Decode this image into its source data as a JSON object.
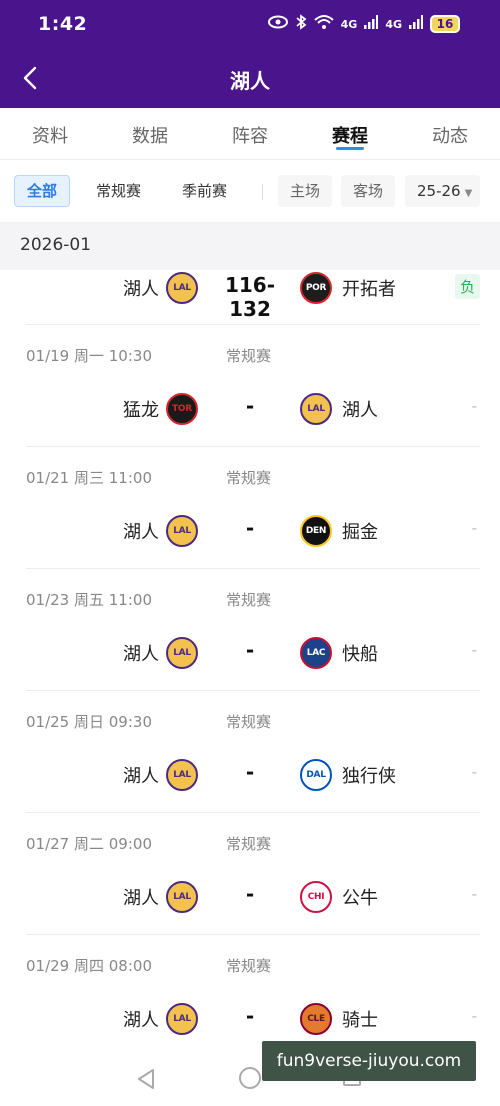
{
  "status_bar": {
    "time": "1:42",
    "signal_1": "4G",
    "signal_2": "4G",
    "battery": "16"
  },
  "header": {
    "title": "湖人"
  },
  "tabs": [
    {
      "label": "资料"
    },
    {
      "label": "数据"
    },
    {
      "label": "阵容"
    },
    {
      "label": "赛程",
      "active": true
    },
    {
      "label": "动态"
    }
  ],
  "filters": {
    "all": "全部",
    "regular": "常规赛",
    "preseason": "季前赛",
    "home": "主场",
    "away": "客场",
    "season": "25-26",
    "season_caret": "▼"
  },
  "month": "2026-01",
  "teams": {
    "LAL": {
      "abbr": "LAL",
      "bg": "#f2c14e",
      "fg": "#4b2a82",
      "ring": "#4b2a82"
    },
    "POR": {
      "abbr": "POR",
      "bg": "#1d1d1d",
      "fg": "#ffffff",
      "ring": "#d7262e"
    },
    "TOR": {
      "abbr": "TOR",
      "bg": "#1a1a1a",
      "fg": "#d7262e",
      "ring": "#d7262e"
    },
    "DEN": {
      "abbr": "DEN",
      "bg": "#111111",
      "fg": "#ffffff",
      "ring": "#fec524"
    },
    "LAC": {
      "abbr": "LAC",
      "bg": "#1d4289",
      "fg": "#ffffff",
      "ring": "#c8102e"
    },
    "DAL": {
      "abbr": "DAL",
      "bg": "#ffffff",
      "fg": "#0053bc",
      "ring": "#0053bc"
    },
    "CHI": {
      "abbr": "CHI",
      "bg": "#ffffff",
      "fg": "#ce1141",
      "ring": "#ce1141"
    },
    "CLE": {
      "abbr": "CLE",
      "bg": "#e27b2e",
      "fg": "#5a1a21",
      "ring": "#860038"
    }
  },
  "games": [
    {
      "date": "",
      "type": "",
      "home": "湖人",
      "home_team": "LAL",
      "score": "116-132",
      "away": "开拓者",
      "away_team": "POR",
      "result": "负"
    },
    {
      "date": "01/19  周一 10:30",
      "type": "常规赛",
      "home": "猛龙",
      "home_team": "TOR",
      "score": "-",
      "away": "湖人",
      "away_team": "LAL",
      "result": "-"
    },
    {
      "date": "01/21  周三 11:00",
      "type": "常规赛",
      "home": "湖人",
      "home_team": "LAL",
      "score": "-",
      "away": "掘金",
      "away_team": "DEN",
      "result": "-"
    },
    {
      "date": "01/23  周五 11:00",
      "type": "常规赛",
      "home": "湖人",
      "home_team": "LAL",
      "score": "-",
      "away": "快船",
      "away_team": "LAC",
      "result": "-"
    },
    {
      "date": "01/25  周日 09:30",
      "type": "常规赛",
      "home": "湖人",
      "home_team": "LAL",
      "score": "-",
      "away": "独行侠",
      "away_team": "DAL",
      "result": "-"
    },
    {
      "date": "01/27  周二 09:00",
      "type": "常规赛",
      "home": "湖人",
      "home_team": "LAL",
      "score": "-",
      "away": "公牛",
      "away_team": "CHI",
      "result": "-"
    },
    {
      "date": "01/29  周四 08:00",
      "type": "常规赛",
      "home": "湖人",
      "home_team": "LAL",
      "score": "-",
      "away": "骑士",
      "away_team": "CLE",
      "result": "-"
    }
  ],
  "watermark": "fun9verse-jiuyou.com"
}
